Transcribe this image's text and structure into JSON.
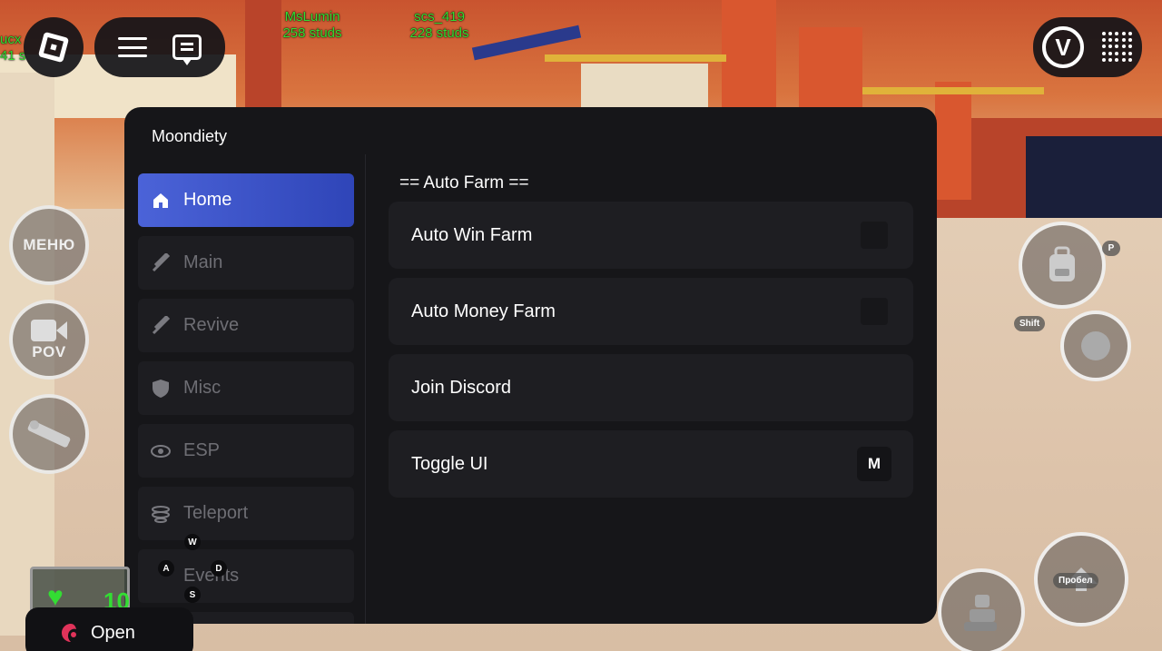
{
  "game": {
    "players": [
      {
        "name": "MsLumin",
        "distance": "258 studs"
      },
      {
        "name": "scs_419",
        "distance": "228 studs"
      },
      {
        "name": "ucx",
        "distance": "41 s"
      }
    ],
    "left_buttons": [
      {
        "label": "МЕНЮ",
        "icon": "menu-icon"
      },
      {
        "label": "POV",
        "icon": "camera-icon"
      },
      {
        "label": "",
        "icon": "tool-icon"
      }
    ],
    "right_buttons": {
      "backpack_key": "P",
      "emote_key": "Shift",
      "jump_key": "Пробел"
    },
    "health_value": "10"
  },
  "panel": {
    "title": "Moondiety",
    "nav": [
      {
        "label": "Home",
        "icon": "home-icon",
        "active": true
      },
      {
        "label": "Main",
        "icon": "sword-icon",
        "active": false
      },
      {
        "label": "Revive",
        "icon": "sword-icon",
        "active": false
      },
      {
        "label": "Misc",
        "icon": "shield-icon",
        "active": false
      },
      {
        "label": "ESP",
        "icon": "eye-icon",
        "active": false
      },
      {
        "label": "Teleport",
        "icon": "teleport-icon",
        "active": false
      },
      {
        "label": "Events",
        "icon": "events-icon",
        "active": false
      }
    ],
    "section_title": "== Auto Farm ==",
    "rows": [
      {
        "label": "Auto Win Farm",
        "control": "toggle"
      },
      {
        "label": "Auto Money Farm",
        "control": "toggle"
      },
      {
        "label": "Join Discord",
        "control": "button"
      },
      {
        "label": "Toggle UI",
        "control": "keybind",
        "key": "M"
      }
    ],
    "wasd": {
      "w": "W",
      "a": "A",
      "s": "S",
      "d": "D"
    }
  },
  "open_button": {
    "label": "Open"
  },
  "colors": {
    "panel_bg": "#161619",
    "nav_active": "#3d54c8",
    "health_green": "#33dd33"
  }
}
